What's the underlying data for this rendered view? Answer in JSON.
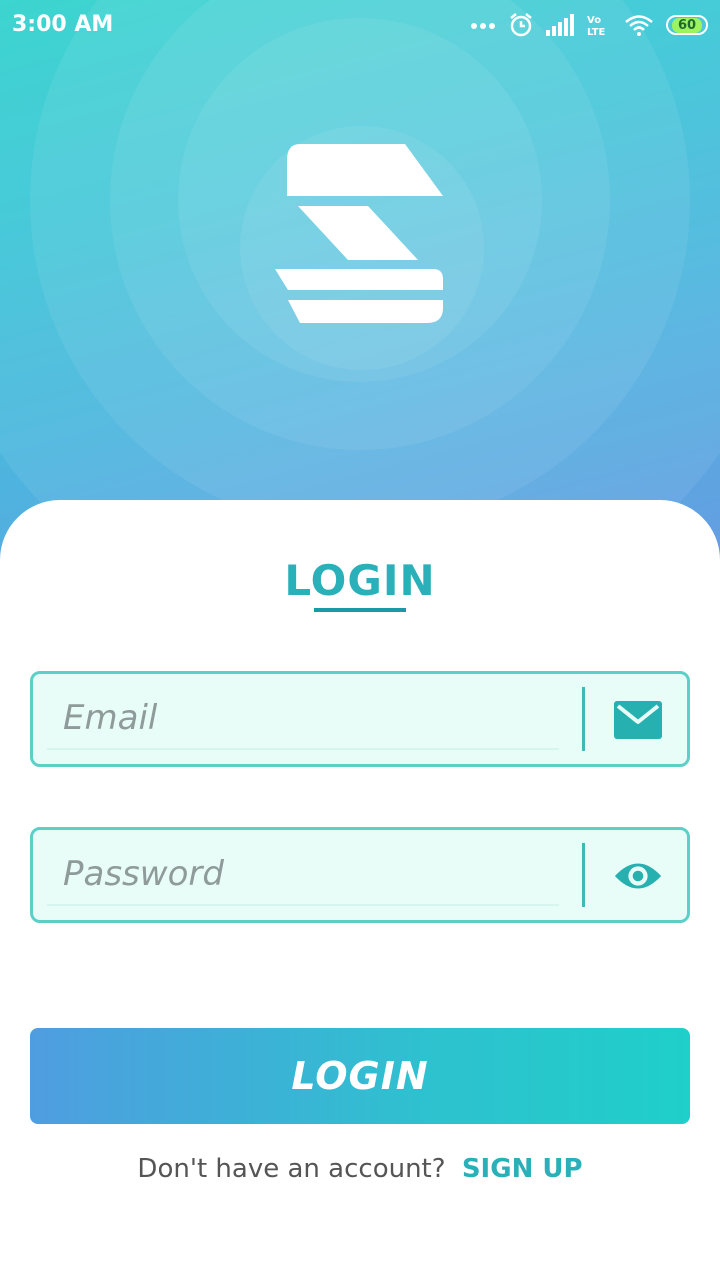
{
  "status_bar": {
    "time": "3:00 AM",
    "battery": "60"
  },
  "login": {
    "title": "LOGIN",
    "email_placeholder": "Email",
    "password_placeholder": "Password",
    "button_label": "LOGIN",
    "signup_prompt": "Don't have an account?",
    "signup_link": "SIGN UP"
  },
  "icons": {
    "email": "envelope-icon",
    "password": "eye-icon",
    "status": [
      "more-dots-icon",
      "alarm-icon",
      "signal-icon",
      "volte-icon",
      "wifi-icon",
      "battery-icon"
    ]
  },
  "colors": {
    "accent": "#2ab0b8",
    "field_border": "#5ccfc7",
    "field_bg": "#e8fdf7"
  }
}
